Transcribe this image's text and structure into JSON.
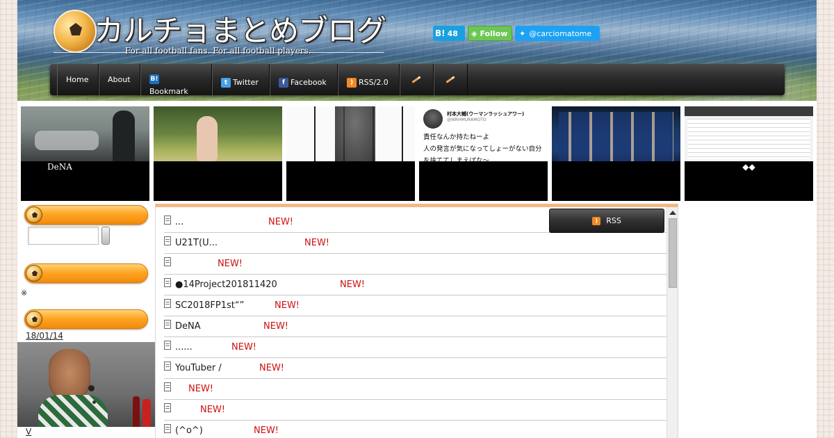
{
  "header": {
    "title": "カルチョまとめブログ",
    "subtitle": "For all football fans.  For all football players."
  },
  "share": {
    "hatena_label": "B!",
    "hatena_count": "48",
    "feedly_label": "Follow",
    "twitter_label": "@carciomatome"
  },
  "nav": {
    "items": [
      "Home",
      "About",
      "Bookmark",
      "Twitter",
      "Facebook",
      "RSS/2.0"
    ]
  },
  "featured": [
    {
      "caption": "DeNA"
    },
    {
      "caption": ""
    },
    {
      "caption": ""
    },
    {
      "caption": "",
      "tweet_name": "村本大輔(ウーマンラッシュアワー)",
      "tweet_handle": "@WRHMURAMOTO",
      "tweet_line1": "責任なんか持たねーよ",
      "tweet_line2": "人の発言が気になってしょーがない自分",
      "tweet_line3": "を捨ててしまえばな〜"
    },
    {
      "caption": ""
    },
    {
      "caption": "◆◆"
    }
  ],
  "sidebar": {
    "note_mark": "※",
    "date": "18/01/14",
    "link": "V"
  },
  "main": {
    "rss_label": "RSS",
    "new_label": "NEW!",
    "items": [
      "...",
      "U21T(U...",
      "",
      "●14Project201811420",
      "SC2018FP1st“”",
      "DeNA",
      "......",
      "YouTuber /",
      "",
      "",
      "(^o^)"
    ]
  }
}
